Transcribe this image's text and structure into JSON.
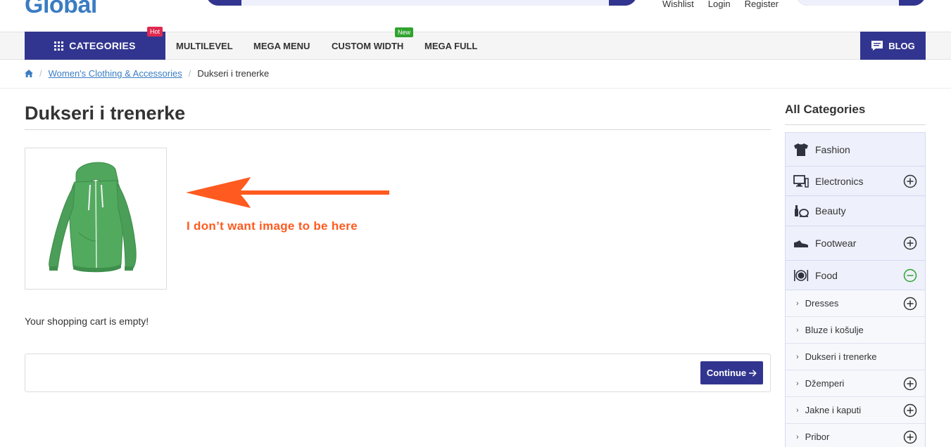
{
  "header": {
    "logo": "Global",
    "links": [
      "Wishlist",
      "Login",
      "Register"
    ]
  },
  "nav": {
    "categories_label": "CATEGORIES",
    "hot_badge": "Hot",
    "new_badge": "New",
    "items": [
      "MULTILEVEL",
      "MEGA MENU",
      "CUSTOM WIDTH",
      "MEGA FULL"
    ],
    "blog_label": "BLOG"
  },
  "breadcrumb": {
    "link": "Women's Clothing & Accessories",
    "current": "Dukseri i trenerke"
  },
  "main": {
    "title": "Dukseri i trenerke",
    "annotation": "I don’t want image to be here",
    "empty_message": "Your shopping cart is empty!",
    "continue_label": "Continue",
    "product_color": "#4fa65c",
    "annotation_color": "#ff5a1f"
  },
  "sidebar": {
    "title": "All Categories",
    "categories": [
      {
        "label": "Fashion",
        "icon": "tshirt-icon",
        "toggle": "none"
      },
      {
        "label": "Electronics",
        "icon": "monitor-icon",
        "toggle": "plus"
      },
      {
        "label": "Beauty",
        "icon": "cosmetics-icon",
        "toggle": "none"
      },
      {
        "label": "Footwear",
        "icon": "shoe-icon",
        "toggle": "plus"
      },
      {
        "label": "Food",
        "icon": "plate-cutlery-icon",
        "toggle": "minus"
      }
    ],
    "subcategories": [
      {
        "label": "Dresses",
        "toggle": "plus"
      },
      {
        "label": "Bluze i košulje",
        "toggle": "none"
      },
      {
        "label": "Dukseri i trenerke",
        "toggle": "none"
      },
      {
        "label": "Džemperi",
        "toggle": "plus"
      },
      {
        "label": "Jakne i kaputi",
        "toggle": "plus"
      },
      {
        "label": "Pribor",
        "toggle": "plus"
      }
    ]
  },
  "colors": {
    "brand": "#32358f",
    "link": "#3a7cc2",
    "hot": "#e0294f",
    "new": "#2fa32f"
  }
}
